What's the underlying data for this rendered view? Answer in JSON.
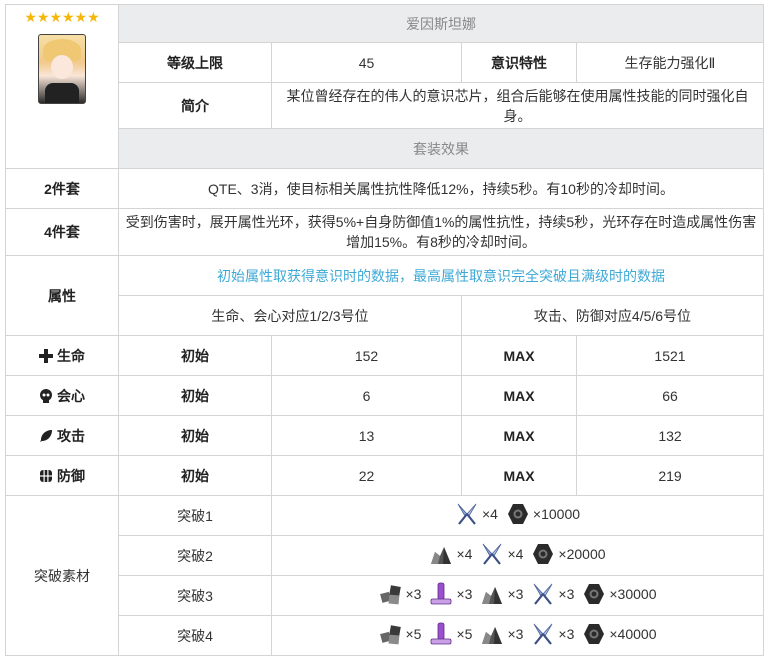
{
  "header": {
    "stars": "★★★★★★",
    "name": "爱因斯坦娜",
    "level_cap_label": "等级上限",
    "level_cap_value": "45",
    "trait_label": "意识特性",
    "trait_value": "生存能力强化Ⅱ",
    "intro_label": "简介",
    "intro_text": "某位曾经存在的伟人的意识芯片，组合后能够在使用属性技能的同时强化自身。",
    "set_effect_header": "套装效果"
  },
  "set_effects": [
    {
      "label": "2件套",
      "text": "QTE、3消，使目标相关属性抗性降低12%，持续5秒。有10秒的冷却时间。"
    },
    {
      "label": "4件套",
      "text": "受到伤害时，展开属性光环，获得5%+自身防御值1%的属性抗性，持续5秒，光环存在时造成属性伤害增加15%。有8秒的冷却时间。"
    }
  ],
  "attributes": {
    "label": "属性",
    "note": "初始属性取获得意识时的数据，最高属性取意识完全突破且满级时的数据",
    "slots_left": "生命、会心对应1/2/3号位",
    "slots_right": "攻击、防御对应4/5/6号位",
    "initial_label": "初始",
    "max_label": "MAX",
    "rows": [
      {
        "name": "生命",
        "icon": "cross-icon",
        "initial": "152",
        "max": "1521"
      },
      {
        "name": "会心",
        "icon": "skull-icon",
        "initial": "6",
        "max": "66"
      },
      {
        "name": "攻击",
        "icon": "feather-icon",
        "initial": "13",
        "max": "132"
      },
      {
        "name": "防御",
        "icon": "shield-icon",
        "initial": "22",
        "max": "219"
      }
    ]
  },
  "breakthrough": {
    "label": "突破素材",
    "rows": [
      {
        "name": "突破1",
        "materials": [
          {
            "icon": "blade-icon",
            "qty": "×4"
          },
          {
            "icon": "hex-nut-icon",
            "qty": "×10000"
          }
        ]
      },
      {
        "name": "突破2",
        "materials": [
          {
            "icon": "ore-icon",
            "qty": "×4"
          },
          {
            "icon": "blade-icon",
            "qty": "×4"
          },
          {
            "icon": "hex-nut-icon",
            "qty": "×20000"
          }
        ]
      },
      {
        "name": "突破3",
        "materials": [
          {
            "icon": "cubes-icon",
            "qty": "×3"
          },
          {
            "icon": "tube-icon",
            "qty": "×3"
          },
          {
            "icon": "ore-icon",
            "qty": "×3"
          },
          {
            "icon": "blade-icon",
            "qty": "×3"
          },
          {
            "icon": "hex-nut-icon",
            "qty": "×30000"
          }
        ]
      },
      {
        "name": "突破4",
        "materials": [
          {
            "icon": "cubes-icon",
            "qty": "×5"
          },
          {
            "icon": "tube-icon",
            "qty": "×5"
          },
          {
            "icon": "ore-icon",
            "qty": "×3"
          },
          {
            "icon": "blade-icon",
            "qty": "×3"
          },
          {
            "icon": "hex-nut-icon",
            "qty": "×40000"
          }
        ]
      }
    ]
  }
}
